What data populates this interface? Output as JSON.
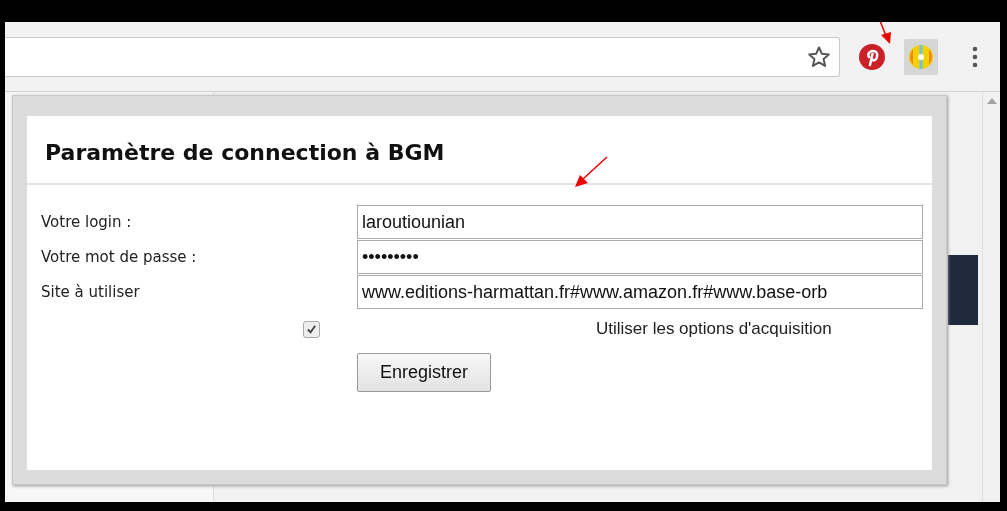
{
  "toolbar": {
    "bookmark_starred": false
  },
  "popup": {
    "title": "Paramètre de connection à BGM",
    "fields": [
      {
        "label": "Votre login :",
        "value": "laroutiounian"
      },
      {
        "label": "Votre mot de passe :",
        "value": "•••••••••"
      },
      {
        "label": "Site à utiliser",
        "value": "www.editions-harmattan.fr#www.amazon.fr#www.base-orb"
      }
    ],
    "option": {
      "checked": true,
      "label": "Utiliser les options d'acquisition"
    },
    "button": "Enregistrer"
  }
}
